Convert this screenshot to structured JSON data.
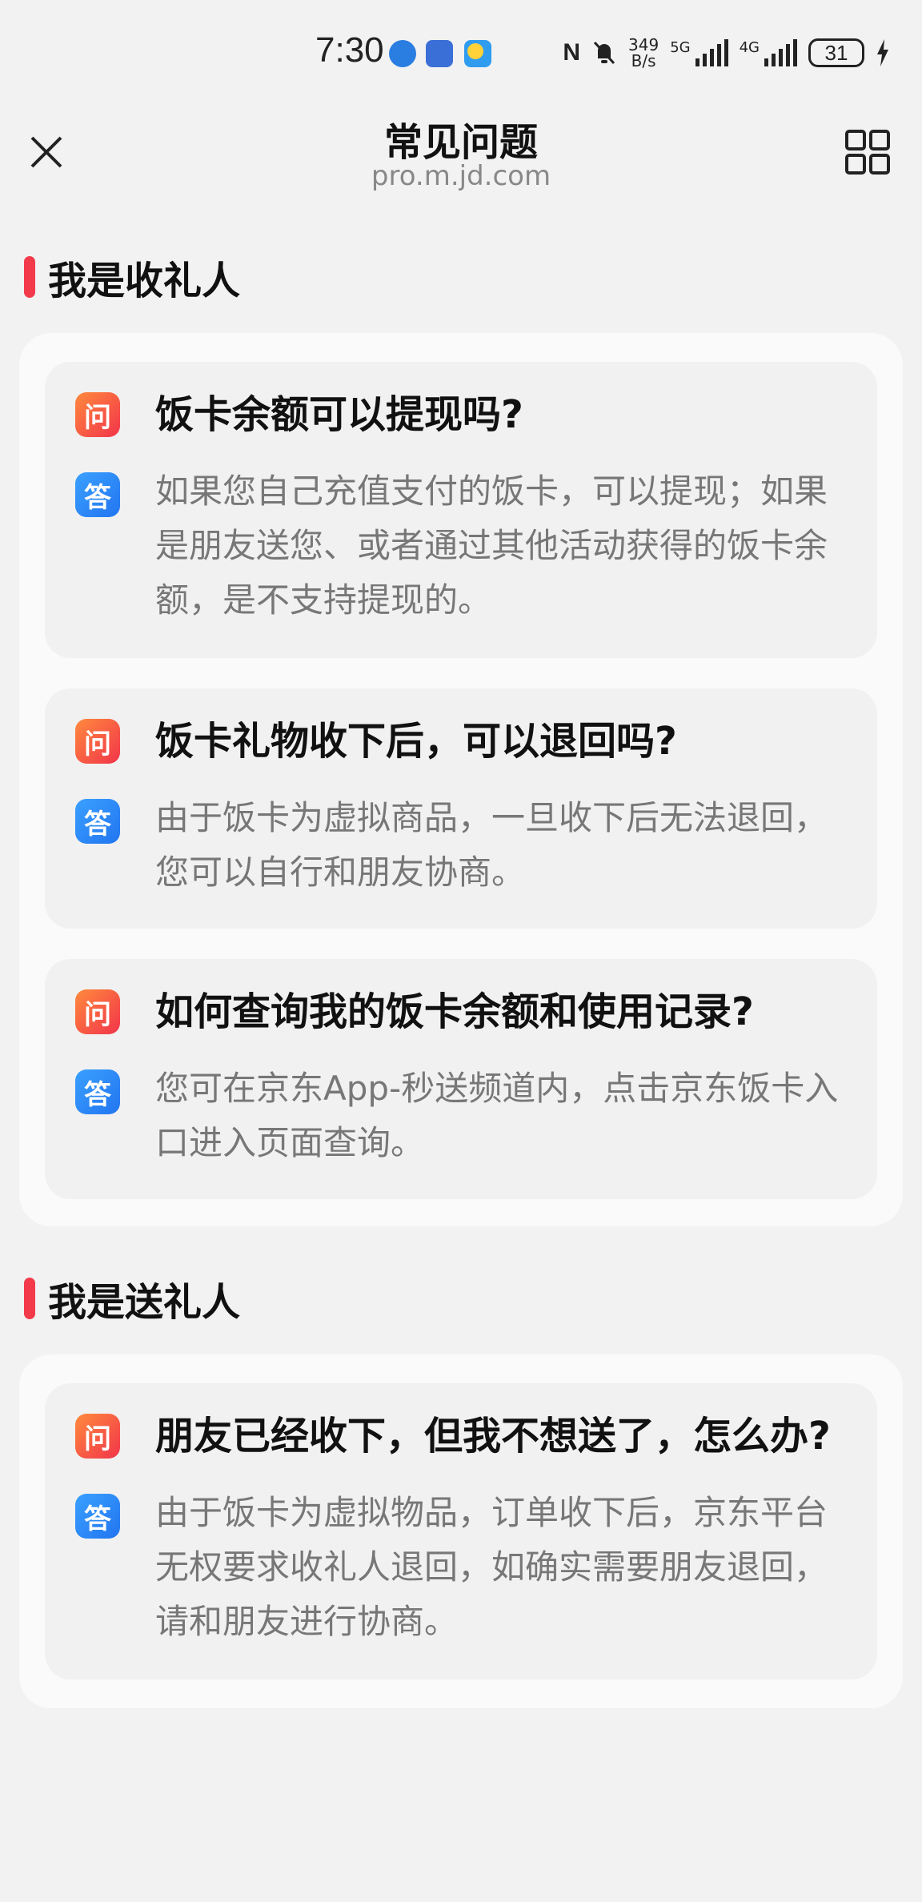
{
  "status_bar": {
    "time": "7:30",
    "net_speed_top": "349",
    "net_speed_bottom": "B/s",
    "sim1": "5G",
    "sim2": "4G",
    "battery": "31"
  },
  "header": {
    "title": "常见问题",
    "subtitle": "pro.m.jd.com"
  },
  "sections": [
    {
      "title": "我是收礼人",
      "items": [
        {
          "q_badge": "问",
          "question": "饭卡余额可以提现吗?",
          "a_badge": "答",
          "answer": "如果您自己充值支付的饭卡，可以提现；如果是朋友送您、或者通过其他活动获得的饭卡余额，是不支持提现的。"
        },
        {
          "q_badge": "问",
          "question": "饭卡礼物收下后，可以退回吗?",
          "a_badge": "答",
          "answer": "由于饭卡为虚拟商品，一旦收下后无法退回，您可以自行和朋友协商。"
        },
        {
          "q_badge": "问",
          "question": "如何查询我的饭卡余额和使用记录?",
          "a_badge": "答",
          "answer": "您可在京东App-秒送频道内，点击京东饭卡入口进入页面查询。"
        }
      ]
    },
    {
      "title": "我是送礼人",
      "items": [
        {
          "q_badge": "问",
          "question": "朋友已经收下，但我不想送了，怎么办?",
          "a_badge": "答",
          "answer": "由于饭卡为虚拟物品，订单收下后，京东平台无权要求收礼人退回，如确实需要朋友退回，请和朋友进行协商。"
        }
      ]
    }
  ],
  "icons": {
    "close": "close-icon",
    "grid": "grid-menu-icon"
  },
  "colors": {
    "accent_red": "#f23a4b",
    "answer_blue": "#2275f0",
    "background": "#f2f2f2"
  }
}
